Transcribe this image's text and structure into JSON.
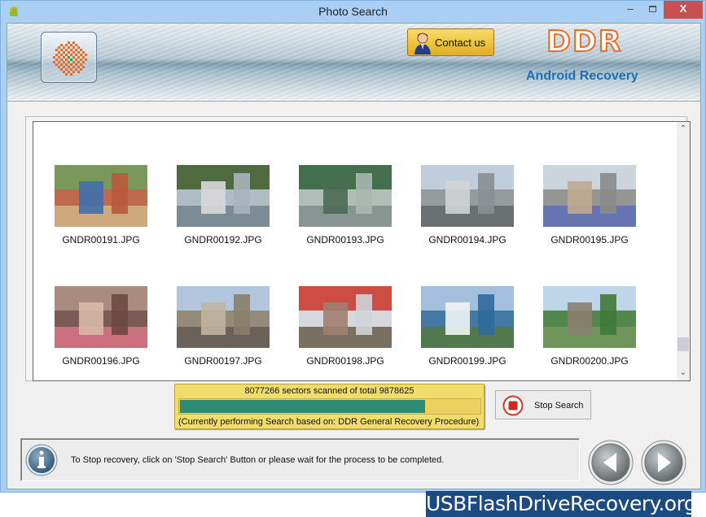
{
  "window": {
    "title": "Photo Search",
    "controls": {
      "minimize": "‒",
      "maximize": "",
      "close": "X"
    }
  },
  "banner": {
    "contact_label": "Contact us",
    "brand": "DDR",
    "product": "Android Recovery",
    "colors": {
      "brand_orange": "#f26a21",
      "product_blue": "#1f6fb5",
      "contact_gold": "#eec540"
    }
  },
  "gallery": {
    "rows": [
      [
        {
          "file": "GNDR00191.JPG"
        },
        {
          "file": "GNDR00192.JPG"
        },
        {
          "file": "GNDR00193.JPG"
        },
        {
          "file": "GNDR00194.JPG"
        },
        {
          "file": "GNDR00195.JPG"
        }
      ],
      [
        {
          "file": "GNDR00196.JPG"
        },
        {
          "file": "GNDR00197.JPG"
        },
        {
          "file": "GNDR00198.JPG"
        },
        {
          "file": "GNDR00199.JPG"
        },
        {
          "file": "GNDR00200.JPG"
        }
      ]
    ],
    "scroll_up_icon": "chevron-up-icon",
    "scroll_down_icon": "chevron-down-icon"
  },
  "progress": {
    "text": "8077266 sectors scanned of total 9878625",
    "scanned": 8077266,
    "total": 9878625,
    "fraction": 0.8177,
    "procedure": "(Currently performing Search based on:  DDR General Recovery Procedure)",
    "bar_color": "#2f8b72",
    "panel_color": "#f1dd6a"
  },
  "stop_button": {
    "label": "Stop Search",
    "icon": "stop-icon"
  },
  "status": {
    "message": "To Stop recovery, click on 'Stop Search' Button or please wait for the process to be completed.",
    "icon": "info-icon"
  },
  "navigation": {
    "back_icon": "arrow-left-icon",
    "next_icon": "arrow-right-icon"
  },
  "watermark": "USBFlashDriveRecovery.org"
}
